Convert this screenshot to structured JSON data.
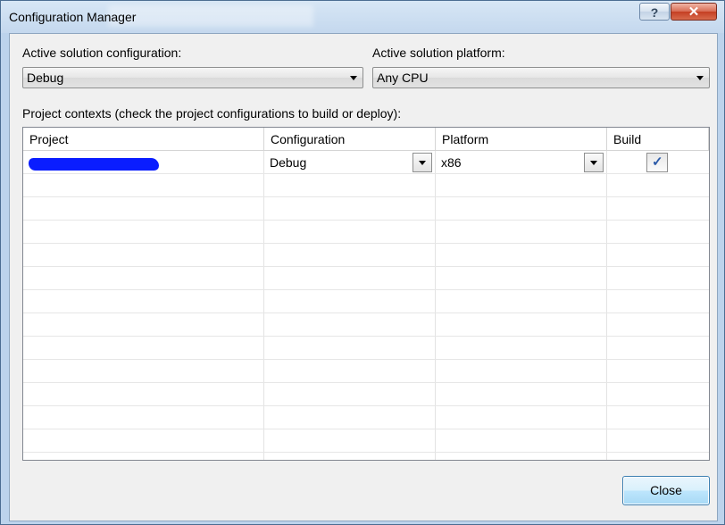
{
  "window": {
    "title": "Configuration Manager",
    "help_glyph": "?",
    "close_glyph": "✕"
  },
  "solution": {
    "config_label": "Active solution configuration:",
    "config_value": "Debug",
    "platform_label": "Active solution platform:",
    "platform_value": "Any CPU"
  },
  "contexts_label": "Project contexts (check the project configurations to build or deploy):",
  "grid": {
    "headers": [
      "Project",
      "Configuration",
      "Platform",
      "Build"
    ],
    "rows": [
      {
        "project": "",
        "configuration": "Debug",
        "platform": "x86",
        "build": true
      }
    ]
  },
  "close_button": "Close",
  "icons": {
    "check": "check-icon",
    "dropdown": "chevron-down-icon"
  }
}
